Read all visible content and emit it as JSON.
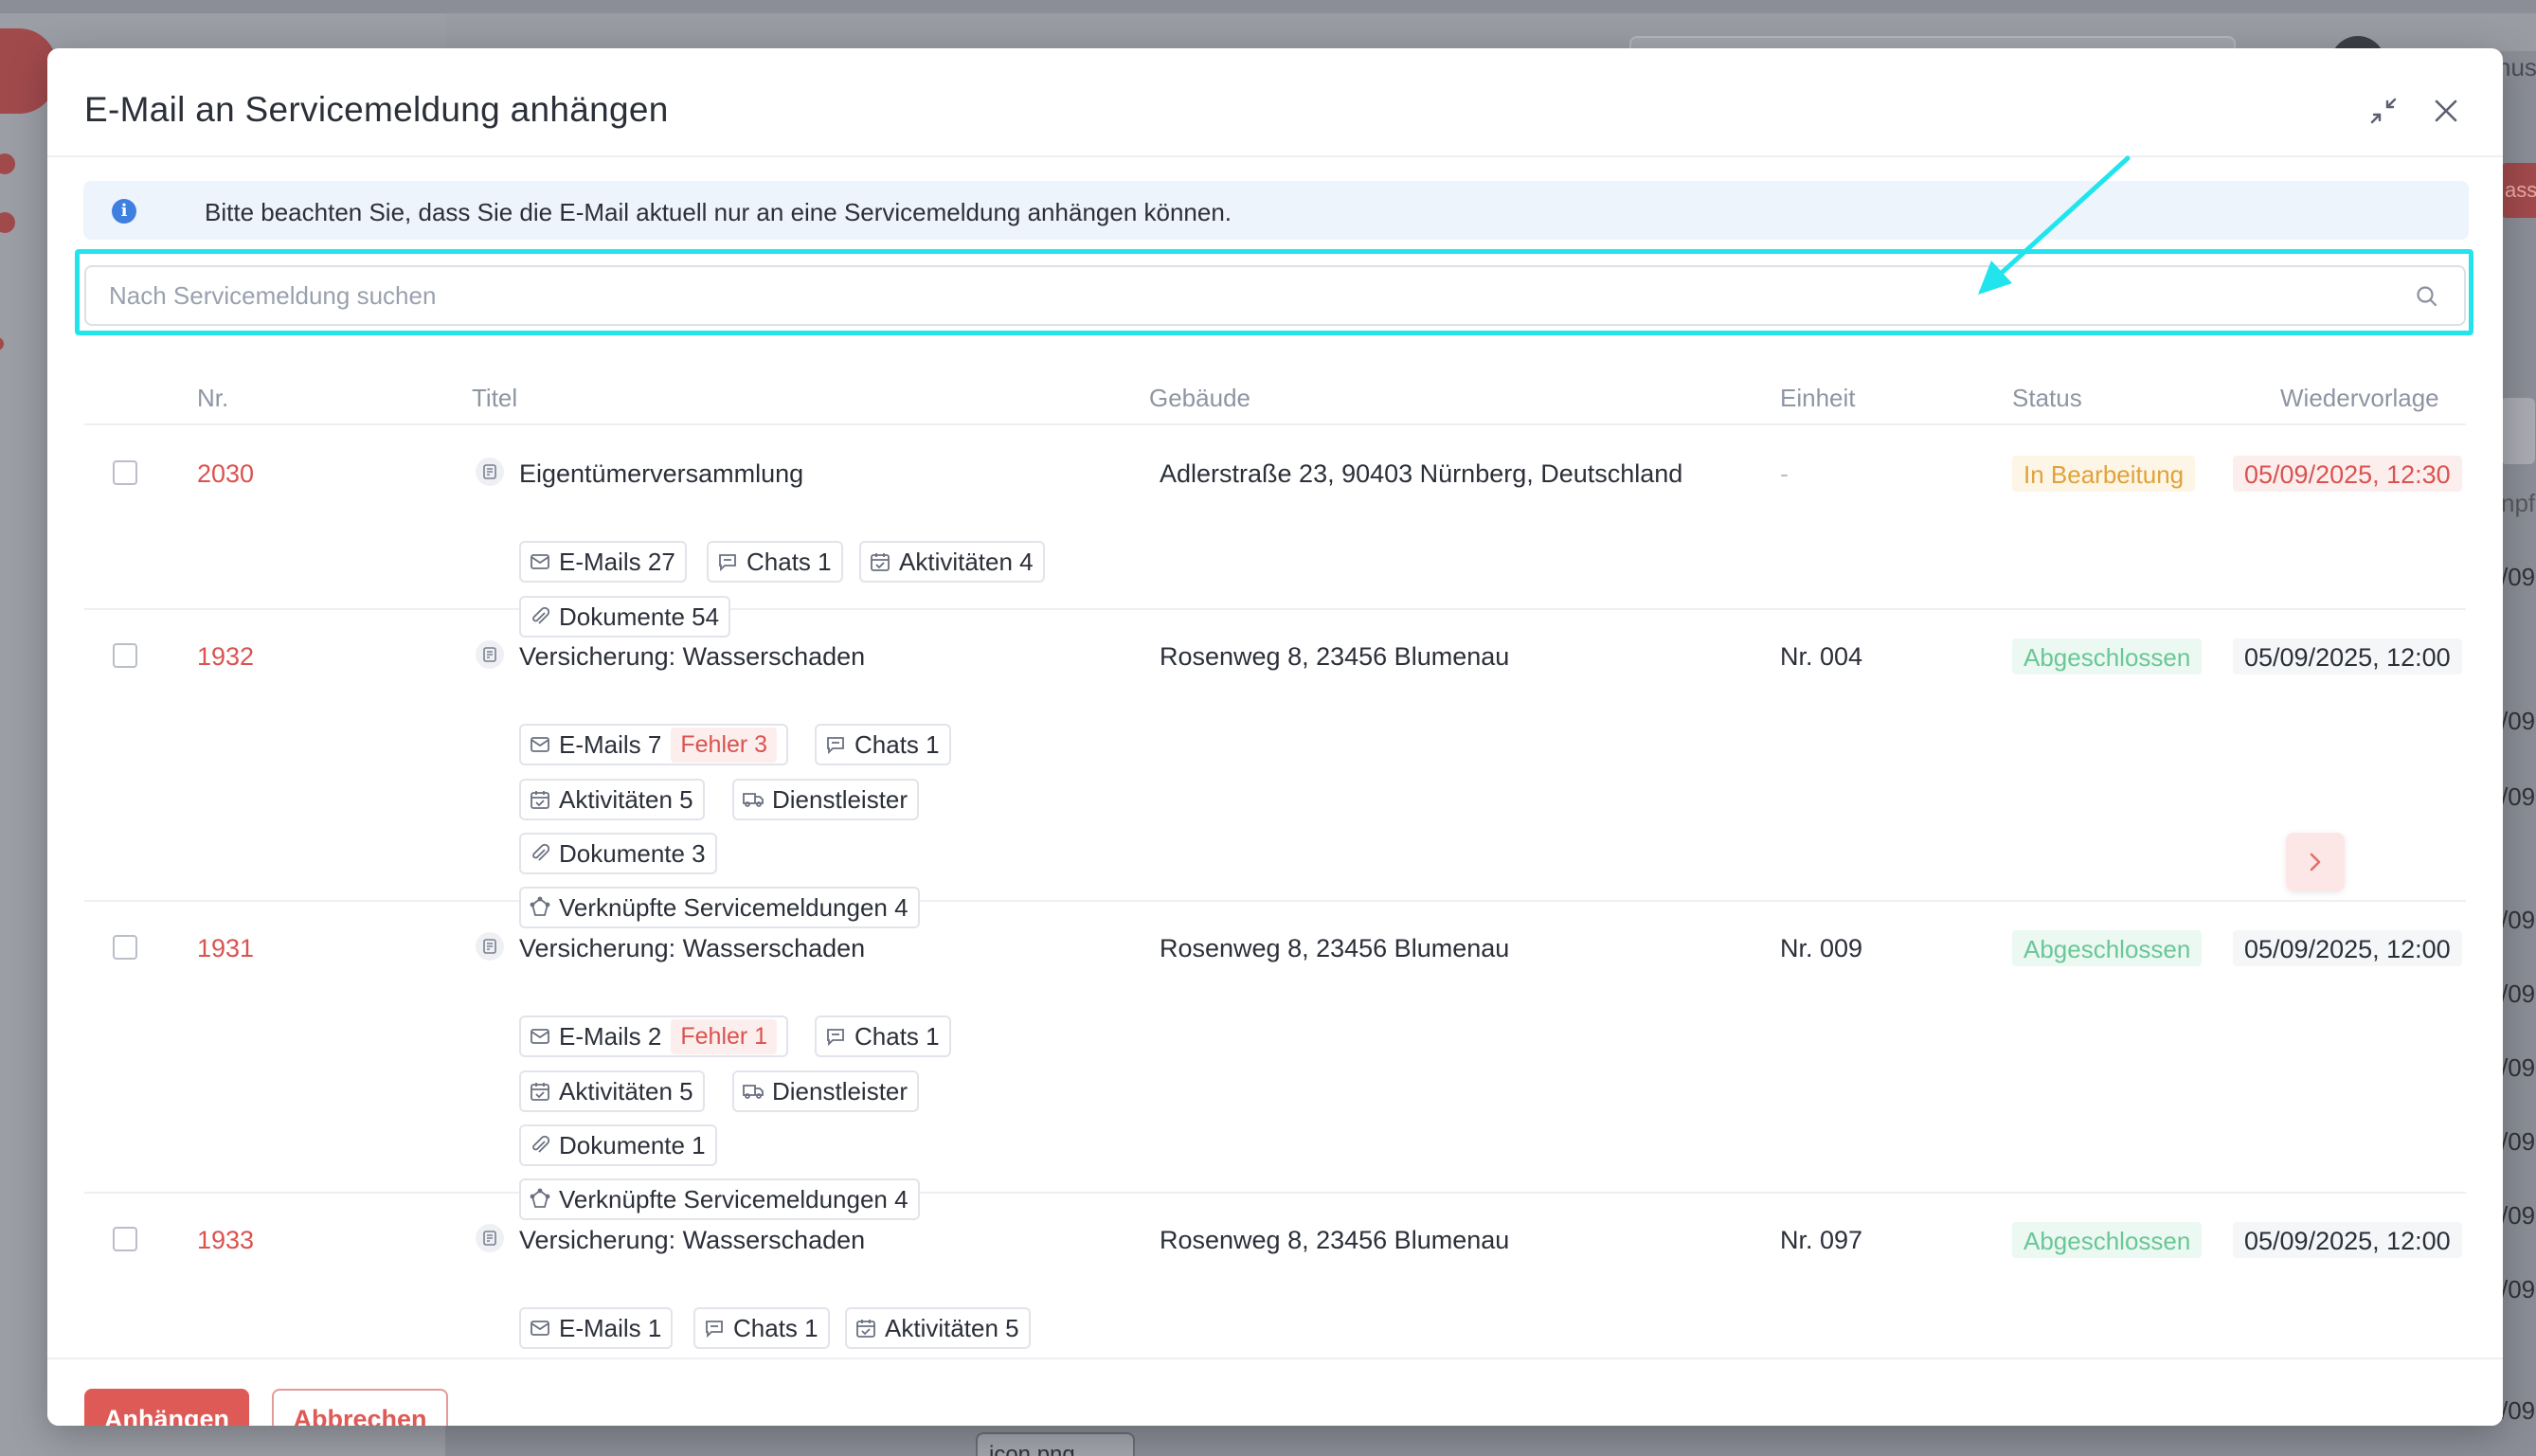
{
  "background": {
    "user_partial": "hus",
    "button_partial": "ass",
    "column_partial": "npf",
    "row_partial": "/09",
    "file_chip": "icon.png"
  },
  "modal": {
    "title": "E-Mail an Servicemeldung anhängen",
    "info_text": "Bitte beachten Sie, dass Sie die E-Mail aktuell nur an eine Servicemeldung anhängen können.",
    "search_placeholder": "Nach Servicemeldung suchen"
  },
  "table": {
    "headers": {
      "nr": "Nr.",
      "titel": "Titel",
      "gebaeude": "Gebäude",
      "einheit": "Einheit",
      "status": "Status",
      "wiedervorlage": "Wiedervorlage"
    },
    "rows": [
      {
        "nr": "2030",
        "title": "Eigentümerversammlung",
        "address": "Adlerstraße 23, 90403 Nürnberg, Deutschland",
        "unit": "-",
        "status": "In Bearbeitung",
        "due": "05/09/2025, 12:30",
        "chips": {
          "emails": "E-Mails 27",
          "chats": "Chats 1",
          "aktivitaeten": "Aktivitäten 4",
          "dokumente": "Dokumente 54"
        }
      },
      {
        "nr": "1932",
        "title": "Versicherung: Wasserschaden",
        "address": "Rosenweg 8, 23456 Blumenau",
        "unit": "Nr. 004",
        "status": "Abgeschlossen",
        "due": "05/09/2025, 12:00",
        "chips": {
          "emails": "E-Mails 7",
          "fehler": "Fehler 3",
          "chats": "Chats 1",
          "aktivitaeten": "Aktivitäten 5",
          "dienstleister": "Dienstleister",
          "dokumente": "Dokumente 3",
          "verknuepfte": "Verknüpfte Servicemeldungen 4"
        }
      },
      {
        "nr": "1931",
        "title": "Versicherung: Wasserschaden",
        "address": "Rosenweg 8, 23456 Blumenau",
        "unit": "Nr. 009",
        "status": "Abgeschlossen",
        "due": "05/09/2025, 12:00",
        "chips": {
          "emails": "E-Mails 2",
          "fehler": "Fehler 1",
          "chats": "Chats 1",
          "aktivitaeten": "Aktivitäten 5",
          "dienstleister": "Dienstleister",
          "dokumente": "Dokumente 1",
          "verknuepfte": "Verknüpfte Servicemeldungen 4"
        }
      },
      {
        "nr": "1933",
        "title": "Versicherung: Wasserschaden",
        "address": "Rosenweg 8, 23456 Blumenau",
        "unit": "Nr. 097",
        "status": "Abgeschlossen",
        "due": "05/09/2025, 12:00",
        "chips": {
          "emails": "E-Mails 1",
          "chats": "Chats 1",
          "aktivitaeten": "Aktivitäten 5"
        }
      }
    ]
  },
  "footer": {
    "attach_label": "Anhängen",
    "cancel_label": "Abbrechen"
  },
  "colors": {
    "accent": "#dd5a56",
    "highlight": "#22e4ec",
    "status_orange": "#e0a23a",
    "status_green": "#69c795"
  }
}
